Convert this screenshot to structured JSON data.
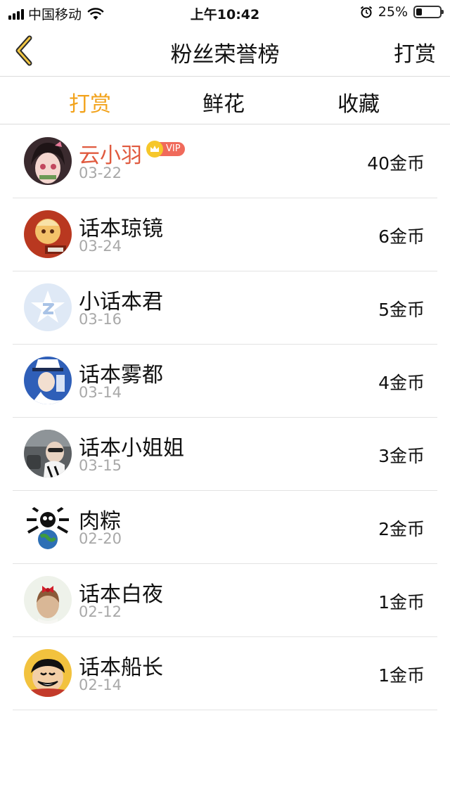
{
  "status_bar": {
    "carrier": "中国移动",
    "time": "上午10:42",
    "battery_text": "25%",
    "battery_level": 0.25
  },
  "nav": {
    "title": "粉丝荣誉榜",
    "action_label": "打赏",
    "back_icon": "chevron-left-icon",
    "accent_color": "#f2a31d"
  },
  "tabs": [
    {
      "label": "打赏",
      "active": true
    },
    {
      "label": "鲜花",
      "active": false
    },
    {
      "label": "收藏",
      "active": false
    }
  ],
  "vip_badge": {
    "label": "VIP"
  },
  "fans": [
    {
      "name": "云小羽",
      "date": "03-22",
      "amount": "40金币",
      "vip": true,
      "avatar": "anime-girl-avatar"
    },
    {
      "name": "话本琼镜",
      "date": "03-24",
      "amount": "6金币",
      "vip": false,
      "avatar": "cartoon-avatar"
    },
    {
      "name": "小话本君",
      "date": "03-16",
      "amount": "5金币",
      "vip": false,
      "avatar": "star-logo-avatar"
    },
    {
      "name": "话本雾都",
      "date": "03-14",
      "amount": "4金币",
      "vip": false,
      "avatar": "anime-character-avatar"
    },
    {
      "name": "话本小姐姐",
      "date": "03-15",
      "amount": "3金币",
      "vip": false,
      "avatar": "photo-avatar"
    },
    {
      "name": "肉粽",
      "date": "02-20",
      "amount": "2金币",
      "vip": false,
      "avatar": "globe-skull-avatar"
    },
    {
      "name": "话本白夜",
      "date": "02-12",
      "amount": "1金币",
      "vip": false,
      "avatar": "girl-bow-avatar"
    },
    {
      "name": "话本船长",
      "date": "02-14",
      "amount": "1金币",
      "vip": false,
      "avatar": "pirate-boy-avatar"
    }
  ]
}
